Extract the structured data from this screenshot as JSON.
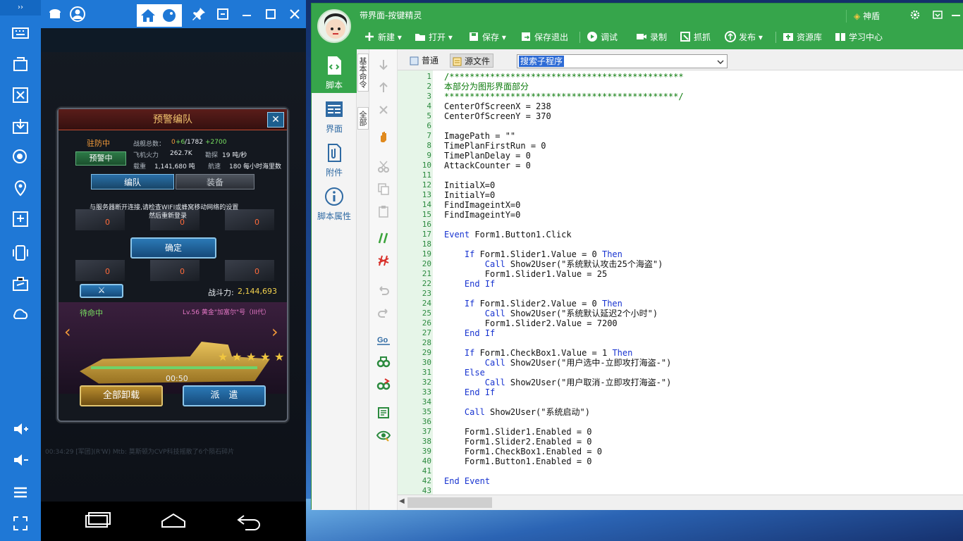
{
  "emulator": {
    "sidebar_top_glyph": "››",
    "sidebar_icons": [
      "keyboard-icon",
      "rotate-screen-icon",
      "screenshot-icon",
      "install-icon",
      "record-icon",
      "location-icon",
      "apk-install-icon",
      "shake-icon",
      "toolbox-icon",
      "cloud-icon",
      "volume-up-icon",
      "volume-down-icon",
      "menu-icon",
      "fullscreen-icon"
    ]
  },
  "game": {
    "dialog_title": "预警编队",
    "close_label": "✕",
    "status_stationed": "驻防中",
    "warning_button": "预警中",
    "stat_ships_label": "战舰总数：",
    "stat_ships_base": "0",
    "stat_ships_plus": "+6",
    "stat_ships_total": "/1782",
    "stat_ships_extra": "+2700",
    "stat_aircraft": "飞机火力",
    "stat_aircraft_val": "262.7K",
    "stat_recon": "勘探",
    "stat_recon_val": "19 吨/秒",
    "stat_load": "载重",
    "stat_load_val": "1,141,680 吨",
    "stat_speed": "航速",
    "stat_speed_val": "180 每小时海里数",
    "tab_formation": "编队",
    "tab_equipment": "装备",
    "message_line1": "与服务器断开连接,请检查WIFI或蜂窝移动网络的设置",
    "message_line2": "然后重新登录",
    "confirm_button": "确定",
    "slot_count": "0",
    "combat_label": "战斗力:",
    "combat_value": "2,144,693",
    "standby": "待命中",
    "ship_name": "Lv.56 黄金\"加富尔\"号（III代）",
    "timer": "00:50",
    "unload_button": "全部卸载",
    "dispatch_button": "派　遣",
    "chat_line": "00:34:29 [军团](R'W) Mtb: 莫斯顿为CVP科技摇散了6个陨石碎片"
  },
  "ide": {
    "title": "带界面-按键精灵",
    "shield_label": "神盾",
    "toolbar": [
      {
        "label": "新建",
        "icon": "new-icon",
        "dropdown": true
      },
      {
        "label": "打开",
        "icon": "open-folder-icon",
        "dropdown": true
      },
      {
        "label": "保存",
        "icon": "save-icon",
        "dropdown": true
      },
      {
        "label": "保存退出",
        "icon": "save-exit-icon",
        "dropdown": false
      },
      {
        "label": "调试",
        "icon": "debug-play-icon",
        "dropdown": false
      },
      {
        "label": "录制",
        "icon": "record-camera-icon",
        "dropdown": false
      },
      {
        "label": "抓抓",
        "icon": "capture-icon",
        "dropdown": false
      },
      {
        "label": "发布",
        "icon": "publish-icon",
        "dropdown": true
      },
      {
        "label": "资源库",
        "icon": "resource-icon",
        "dropdown": false
      },
      {
        "label": "学习中心",
        "icon": "learn-icon",
        "dropdown": false
      }
    ],
    "left_nav": [
      {
        "label": "脚本",
        "icon": "script-icon",
        "active": true
      },
      {
        "label": "界面",
        "icon": "interface-icon",
        "active": false
      },
      {
        "label": "附件",
        "icon": "attachment-icon",
        "active": false
      },
      {
        "label": "脚本属性",
        "icon": "info-icon",
        "active": false
      }
    ],
    "vertical_tabs": [
      "基本命令",
      "全部"
    ],
    "editor_tabs": [
      {
        "label": "普通",
        "selected": false
      },
      {
        "label": "源文件",
        "selected": true
      }
    ],
    "search_combo": "搜索子程序",
    "code_lines": [
      {
        "n": "1",
        "t": "/**********************************************",
        "c": "cm"
      },
      {
        "n": "2",
        "t": "本部分为图形界面部分",
        "c": "cm"
      },
      {
        "n": "3",
        "t": "**********************************************/",
        "c": "cm"
      },
      {
        "n": "4",
        "t": "CenterOfScreenX = 238",
        "c": ""
      },
      {
        "n": "5",
        "t": "CenterOfScreenY = 370",
        "c": ""
      },
      {
        "n": "6",
        "t": "",
        "c": ""
      },
      {
        "n": "7",
        "t": "ImagePath = \"\"",
        "c": ""
      },
      {
        "n": "8",
        "t": "TimePlanFirstRun = 0",
        "c": ""
      },
      {
        "n": "9",
        "t": "TimePlanDelay = 0",
        "c": ""
      },
      {
        "n": "10",
        "t": "AttackCounter = 0",
        "c": ""
      },
      {
        "n": "11",
        "t": "",
        "c": ""
      },
      {
        "n": "12",
        "t": "InitialX=0",
        "c": ""
      },
      {
        "n": "13",
        "t": "InitialY=0",
        "c": ""
      },
      {
        "n": "14",
        "t": "FindImageintX=0",
        "c": ""
      },
      {
        "n": "15",
        "t": "FindImageintY=0",
        "c": ""
      },
      {
        "n": "16",
        "t": "",
        "c": ""
      },
      {
        "n": "17",
        "t": "Event Form1.Button1.Click",
        "c": "ev"
      },
      {
        "n": "18",
        "t": "",
        "c": ""
      },
      {
        "n": "19",
        "t": "    If Form1.Slider1.Value = 0 Then",
        "c": "if"
      },
      {
        "n": "20",
        "t": "        Call Show2User(\"系统默认攻击25个海盗\")",
        "c": "call"
      },
      {
        "n": "21",
        "t": "        Form1.Slider1.Value = 25",
        "c": ""
      },
      {
        "n": "22",
        "t": "    End If",
        "c": "kwline"
      },
      {
        "n": "23",
        "t": "",
        "c": ""
      },
      {
        "n": "24",
        "t": "    If Form1.Slider2.Value = 0 Then",
        "c": "if"
      },
      {
        "n": "25",
        "t": "        Call Show2User(\"系统默认延迟2个小时\")",
        "c": "call"
      },
      {
        "n": "26",
        "t": "        Form1.Slider2.Value = 7200",
        "c": ""
      },
      {
        "n": "27",
        "t": "    End If",
        "c": "kwline"
      },
      {
        "n": "28",
        "t": "",
        "c": ""
      },
      {
        "n": "29",
        "t": "    If Form1.CheckBox1.Value = 1 Then",
        "c": "if"
      },
      {
        "n": "30",
        "t": "        Call Show2User(\"用户选中-立即攻打海盗-\")",
        "c": "call"
      },
      {
        "n": "31",
        "t": "    Else",
        "c": "kwline"
      },
      {
        "n": "32",
        "t": "        Call Show2User(\"用户取消-立即攻打海盗-\")",
        "c": "call"
      },
      {
        "n": "33",
        "t": "    End If",
        "c": "kwline"
      },
      {
        "n": "34",
        "t": "",
        "c": ""
      },
      {
        "n": "35",
        "t": "    Call Show2User(\"系统启动\")",
        "c": "call"
      },
      {
        "n": "36",
        "t": "",
        "c": ""
      },
      {
        "n": "37",
        "t": "    Form1.Slider1.Enabled = 0",
        "c": ""
      },
      {
        "n": "38",
        "t": "    Form1.Slider2.Enabled = 0",
        "c": ""
      },
      {
        "n": "39",
        "t": "    Form1.CheckBox1.Enabled = 0",
        "c": ""
      },
      {
        "n": "40",
        "t": "    Form1.Button1.Enabled = 0",
        "c": ""
      },
      {
        "n": "41",
        "t": "",
        "c": ""
      },
      {
        "n": "42",
        "t": "End Event",
        "c": "kwline"
      },
      {
        "n": "43",
        "t": "",
        "c": ""
      }
    ]
  },
  "colors": {
    "ide_green": "#36a54b",
    "emulator_blue": "#1f78d6",
    "keyword_blue": "#1733d0",
    "comment_green": "#0a7a0a"
  }
}
